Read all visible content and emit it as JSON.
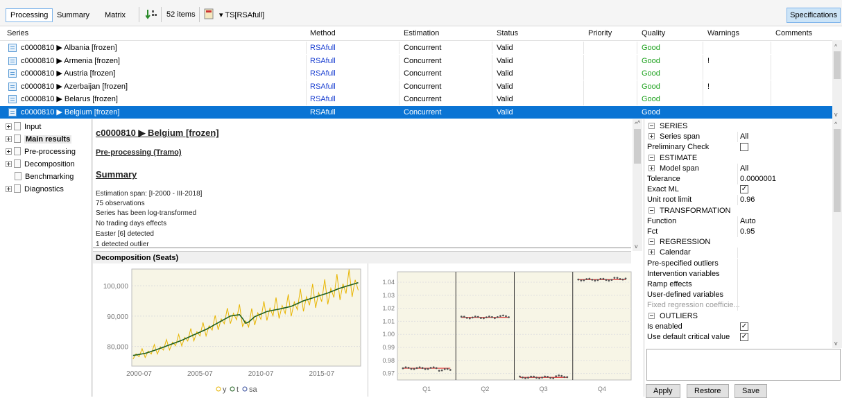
{
  "toolbar": {
    "tabs": [
      "Processing",
      "Summary",
      "Matrix"
    ],
    "items_count": "52 items",
    "ts_label": "▾ TS[RSAfull]",
    "specifications": "Specifications"
  },
  "table": {
    "headers": [
      "Series",
      "Method",
      "Estimation",
      "Status",
      "Priority",
      "Quality",
      "Warnings",
      "Comments"
    ],
    "rows": [
      {
        "series": "c0000810 ▶ Albania [frozen]",
        "method": "RSAfull",
        "estimation": "Concurrent",
        "status": "Valid",
        "quality": "Good",
        "warnings": ""
      },
      {
        "series": "c0000810 ▶ Armenia [frozen]",
        "method": "RSAfull",
        "estimation": "Concurrent",
        "status": "Valid",
        "quality": "Good",
        "warnings": "!"
      },
      {
        "series": "c0000810 ▶ Austria [frozen]",
        "method": "RSAfull",
        "estimation": "Concurrent",
        "status": "Valid",
        "quality": "Good",
        "warnings": ""
      },
      {
        "series": "c0000810 ▶ Azerbaijan [frozen]",
        "method": "RSAfull",
        "estimation": "Concurrent",
        "status": "Valid",
        "quality": "Good",
        "warnings": "!"
      },
      {
        "series": "c0000810 ▶ Belarus [frozen]",
        "method": "RSAfull",
        "estimation": "Concurrent",
        "status": "Valid",
        "quality": "Good",
        "warnings": ""
      },
      {
        "series": "c0000810 ▶ Belgium [frozen]",
        "method": "RSAfull",
        "estimation": "Concurrent",
        "status": "Valid",
        "quality": "Good",
        "warnings": ""
      }
    ],
    "colors": {
      "method": "#1a3fd1",
      "good": "#1aa01a",
      "selected": "#0a74d4"
    }
  },
  "tree": {
    "items": [
      "Input",
      "Main results",
      "Pre-processing",
      "Decomposition",
      "Benchmarking",
      "Diagnostics"
    ]
  },
  "doc": {
    "title": "c0000810 ▶ Belgium [frozen]",
    "preprocessing": "Pre-processing (Tramo)",
    "summary": "Summary",
    "lines": [
      "Estimation span: [I-2000 - III-2018]",
      "75 observations",
      "Series has been log-transformed",
      "No trading days effects",
      "Easter [6] detected",
      "1 detected outlier"
    ],
    "decomposition": "Decomposition (Seats)"
  },
  "chart_data": [
    {
      "type": "line",
      "x": [
        "2000-07",
        "2005-07",
        "2010-07",
        "2015-07"
      ],
      "series": [
        {
          "name": "y"
        },
        {
          "name": "t"
        },
        {
          "name": "sa"
        }
      ],
      "yticks": [
        "80,000",
        "90,000",
        "100,000"
      ],
      "approx_trend": [
        [
          2000.0,
          77000
        ],
        [
          2001.0,
          77700
        ],
        [
          2002.0,
          79000
        ],
        [
          2003.0,
          80500
        ],
        [
          2004.0,
          82000
        ],
        [
          2005.0,
          83800
        ],
        [
          2006.0,
          85600
        ],
        [
          2007.0,
          87800
        ],
        [
          2008.0,
          90000
        ],
        [
          2008.8,
          90500
        ],
        [
          2009.3,
          87300
        ],
        [
          2010.0,
          89800
        ],
        [
          2011.0,
          91500
        ],
        [
          2012.0,
          92300
        ],
        [
          2013.0,
          93200
        ],
        [
          2014.0,
          95000
        ],
        [
          2015.0,
          96300
        ],
        [
          2016.0,
          97600
        ],
        [
          2017.0,
          99200
        ],
        [
          2018.5,
          101000
        ]
      ],
      "colors": {
        "y": "#e8b500",
        "t": "#1f5f1f",
        "sa": "#334a9a"
      }
    },
    {
      "type": "scatter",
      "categories": [
        "Q1",
        "Q2",
        "Q3",
        "Q4"
      ],
      "yticks": [
        "0.97",
        "0.98",
        "0.99",
        "1.00",
        "1.01",
        "1.02",
        "1.03",
        "1.04"
      ],
      "ylim": [
        0.965,
        1.048
      ],
      "means": [
        0.974,
        1.013,
        0.967,
        1.042
      ]
    }
  ],
  "specs": {
    "rows": [
      {
        "type": "section",
        "label": "SERIES"
      },
      {
        "type": "expand",
        "label": "Series span",
        "value": "All"
      },
      {
        "type": "check",
        "label": "Preliminary Check",
        "checked": false
      },
      {
        "type": "section",
        "label": "ESTIMATE"
      },
      {
        "type": "expand",
        "label": "Model span",
        "value": "All"
      },
      {
        "type": "value",
        "label": "Tolerance",
        "value": "0.0000001"
      },
      {
        "type": "check",
        "label": "Exact ML",
        "checked": true
      },
      {
        "type": "value",
        "label": "Unit root limit",
        "value": "0.96"
      },
      {
        "type": "section",
        "label": "TRANSFORMATION"
      },
      {
        "type": "value",
        "label": "Function",
        "value": "Auto"
      },
      {
        "type": "value",
        "label": "Fct",
        "value": "0.95"
      },
      {
        "type": "section",
        "label": "REGRESSION"
      },
      {
        "type": "expand",
        "label": "Calendar",
        "value": ""
      },
      {
        "type": "value",
        "label": "Pre-specified outliers",
        "value": ""
      },
      {
        "type": "value",
        "label": "Intervention variables",
        "value": ""
      },
      {
        "type": "value",
        "label": "Ramp effects",
        "value": ""
      },
      {
        "type": "value",
        "label": "User-defined variables",
        "value": ""
      },
      {
        "type": "grey",
        "label": "Fixed regression coefficie...",
        "value": ""
      },
      {
        "type": "section",
        "label": "OUTLIERS"
      },
      {
        "type": "check",
        "label": "Is enabled",
        "checked": true
      },
      {
        "type": "check",
        "label": "Use default critical value",
        "checked": true
      }
    ],
    "buttons": [
      "Apply",
      "Restore",
      "Save"
    ]
  }
}
